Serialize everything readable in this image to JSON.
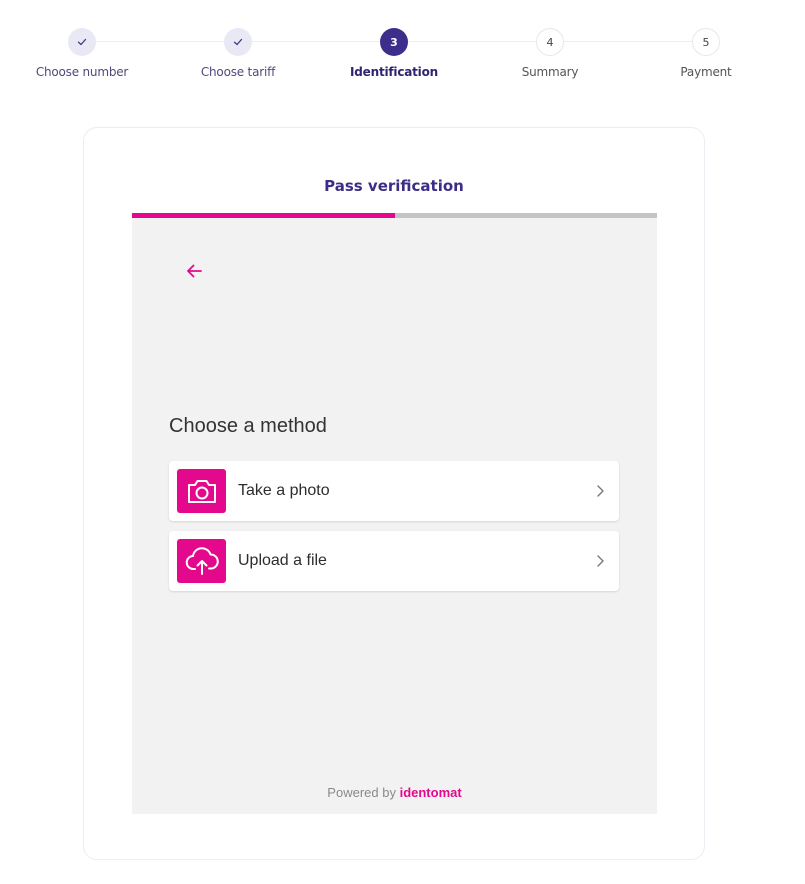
{
  "stepper": {
    "steps": [
      {
        "number": "1",
        "label": "Choose number",
        "state": "done",
        "icon": "check-icon"
      },
      {
        "number": "2",
        "label": "Choose tariff",
        "state": "done",
        "icon": "check-icon"
      },
      {
        "number": "3",
        "label": "Identification",
        "state": "current"
      },
      {
        "number": "4",
        "label": "Summary",
        "state": "todo"
      },
      {
        "number": "5",
        "label": "Payment",
        "state": "todo"
      }
    ]
  },
  "card": {
    "title": "Pass verification",
    "progress_fraction": 0.5
  },
  "panel": {
    "back_icon": "arrow-left-icon",
    "method_title": "Choose a method",
    "options": [
      {
        "label": "Take a photo",
        "icon": "camera-icon"
      },
      {
        "label": "Upload a file",
        "icon": "cloud-upload-icon"
      }
    ],
    "powered_by": "Powered by",
    "brand": "identomat"
  },
  "colors": {
    "accent": "#e4088c",
    "primary": "#3b2e86",
    "panel_bg": "#f2f2f2"
  }
}
